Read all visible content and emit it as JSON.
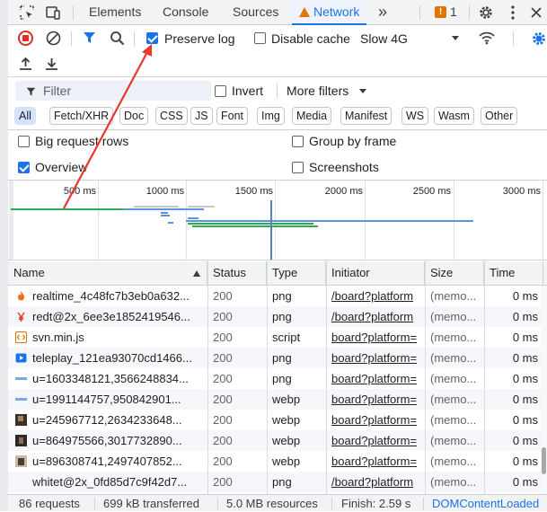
{
  "tabs": {
    "elements": "Elements",
    "console": "Console",
    "sources": "Sources",
    "network": "Network",
    "more": "»",
    "issues_count": "1"
  },
  "toolbar": {
    "preserve_log": "Preserve log",
    "disable_cache": "Disable cache",
    "throttling": "Slow 4G",
    "preserve_log_checked": true,
    "disable_cache_checked": false
  },
  "filter": {
    "placeholder": "Filter",
    "invert": "Invert",
    "more_filters": "More filters",
    "types": [
      "All",
      "Fetch/XHR",
      "Doc",
      "CSS",
      "JS",
      "Font",
      "Img",
      "Media",
      "Manifest",
      "WS",
      "Wasm",
      "Other"
    ],
    "active_type": "All"
  },
  "options": {
    "big_request_rows": "Big request rows",
    "group_by_frame": "Group by frame",
    "overview": "Overview",
    "screenshots": "Screenshots",
    "overview_checked": true
  },
  "overview": {
    "ticks": [
      "500 ms",
      "1000 ms",
      "1500 ms",
      "2000 ms",
      "2500 ms",
      "3000 ms"
    ]
  },
  "table": {
    "headers": {
      "name": "Name",
      "status": "Status",
      "type": "Type",
      "initiator": "Initiator",
      "size": "Size",
      "time": "Time"
    },
    "rows": [
      {
        "name": "realtime_4c48fc7b3eb0a632...",
        "status": "200",
        "type": "png",
        "initiator": "/board?platform",
        "size": "(memo...",
        "time": "0 ms",
        "icon": "flame-icon"
      },
      {
        "name": "redt@2x_6ee3e1852419546...",
        "status": "200",
        "type": "png",
        "initiator": "/board?platform",
        "size": "(memo...",
        "time": "0 ms",
        "icon": "yen-icon"
      },
      {
        "name": "svn.min.js",
        "status": "200",
        "type": "script",
        "initiator": "board?platform=",
        "size": "(memo...",
        "time": "0 ms",
        "icon": "script-icon"
      },
      {
        "name": "teleplay_121ea93070cd1466...",
        "status": "200",
        "type": "png",
        "initiator": "board?platform=",
        "size": "(memo...",
        "time": "0 ms",
        "icon": "play-icon"
      },
      {
        "name": "u=1603348121,3566248834...",
        "status": "200",
        "type": "png",
        "initiator": "board?platform=",
        "size": "(memo...",
        "time": "0 ms",
        "icon": "image-icon"
      },
      {
        "name": "u=1991144757,950842901...",
        "status": "200",
        "type": "webp",
        "initiator": "board?platform=",
        "size": "(memo...",
        "time": "0 ms",
        "icon": "image-icon"
      },
      {
        "name": "u=245967712,2634233648...",
        "status": "200",
        "type": "webp",
        "initiator": "board?platform=",
        "size": "(memo...",
        "time": "0 ms",
        "icon": "photo-icon"
      },
      {
        "name": "u=864975566,3017732890...",
        "status": "200",
        "type": "webp",
        "initiator": "board?platform=",
        "size": "(memo...",
        "time": "0 ms",
        "icon": "photo-icon"
      },
      {
        "name": "u=896308741,2497407852...",
        "status": "200",
        "type": "webp",
        "initiator": "board?platform=",
        "size": "(memo...",
        "time": "0 ms",
        "icon": "photo-icon"
      },
      {
        "name": "whitet@2x_0fd85d7c9f42d7...",
        "status": "200",
        "type": "png",
        "initiator": "/board?platform",
        "size": "(memo...",
        "time": "0 ms",
        "icon": "blank-icon"
      }
    ]
  },
  "status": {
    "requests": "86 requests",
    "transferred": "699 kB transferred",
    "resources": "5.0 MB resources",
    "finish": "Finish: 2.59 s",
    "dom": "DOMContentLoaded"
  },
  "colors": {
    "accent": "#1a73e8",
    "warning": "#e37400",
    "record": "#d93025",
    "annotation_arrow": "#e8372c"
  }
}
